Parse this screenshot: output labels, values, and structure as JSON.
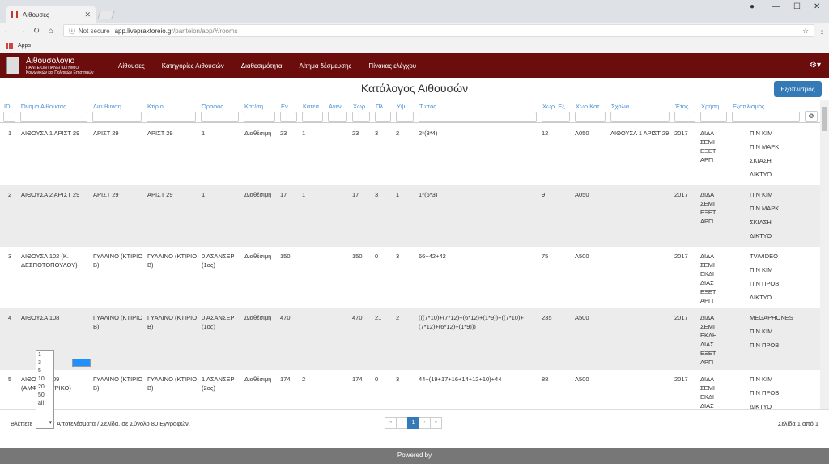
{
  "browser": {
    "tab_title": "Αίθουσες",
    "not_secure": "Not secure",
    "url_host": "app.livepraktoreio.gr",
    "url_path": "/panteion/app/#/rooms",
    "bookmark": "Apps"
  },
  "app": {
    "logo_title": "Αιθουσολόγιο",
    "logo_sub1": "ΠΑΝΤΕΙΟΝ ΠΑΝΕΠΙΣΤΗΜΙΟ",
    "logo_sub2": "Κοινωνικών και Πολιτικών Επιστημών",
    "nav": [
      "Αίθουσες",
      "Κατηγορίες Αιθουσών",
      "Διαθεσιμότητα",
      "Αίτημα δέσμευσης",
      "Πίνακας ελέγχου"
    ]
  },
  "page": {
    "title": "Κατάλογος Αιθουσών",
    "equip_button": "Εξοπλισμός"
  },
  "table": {
    "headers": [
      "ID",
      "Όνομα Αιθουσας",
      "Διευθυνση",
      "Κτίριο",
      "Όροφος",
      "Κατ/ση",
      "Εν.",
      "Κατεσ.",
      "Ανεν.",
      "Χωρ.",
      "Πλ.",
      "Υψ.",
      "Τυπος",
      "Χωρ. Εξ.",
      "Χωρ.Κατ.",
      "Σχόλια",
      "Έτος",
      "Χρήση",
      "Εξοπλισμός"
    ],
    "rows": [
      {
        "id": "1",
        "name": "ΑΙΘΟΥΣΑ 1 ΑΡΙΣΤ 29",
        "address": "ΑΡΙΣΤ 29",
        "building": "ΑΡΙΣΤ 29",
        "floor": "1",
        "status": "Διαθέσιμη",
        "en": "23",
        "kates": "1",
        "anen": "",
        "xor": "23",
        "pl": "3",
        "ips": "2",
        "type": "2*(3*4)",
        "xorex": "12",
        "xorkat": "A050",
        "comments": "ΑΙΘΟΥΣΑ 1 ΑΡΙΣΤ 29",
        "year": "2017",
        "use": [
          "ΔΙΔΑ",
          "ΣΕΜΙ",
          "ΕΞΕΤ",
          "ΑΡΓΙ"
        ],
        "equip": [
          "ΠΙΝ ΚΙΜ",
          "ΠΙΝ ΜΑΡΚ",
          "ΣΚΙΑΣΗ",
          "ΔΙΚΤΥΟ"
        ]
      },
      {
        "id": "2",
        "name": "ΑΙΘΟΥΣΑ 2 ΑΡΙΣΤ 29",
        "address": "ΑΡΙΣΤ 29",
        "building": "ΑΡΙΣΤ 29",
        "floor": "1",
        "status": "Διαθέσιμη",
        "en": "17",
        "kates": "1",
        "anen": "",
        "xor": "17",
        "pl": "3",
        "ips": "1",
        "type": "1*(6*3)",
        "xorex": "9",
        "xorkat": "A050",
        "comments": "",
        "year": "2017",
        "use": [
          "ΔΙΔΑ",
          "ΣΕΜΙ",
          "ΕΞΕΤ",
          "ΑΡΓΙ"
        ],
        "equip": [
          "ΠΙΝ ΚΙΜ",
          "ΠΙΝ ΜΑΡΚ",
          "ΣΚΙΑΣΗ",
          "ΔΙΚΤΥΟ"
        ]
      },
      {
        "id": "3",
        "name": "ΑΙΘΟΥΣΑ 102 (Κ. ΔΕΣΠΟΤΟΠΟΥΛΟΥ)",
        "address": "ΓΥΑΛΙΝΟ (ΚΤΙΡΙΟ Β)",
        "building": "ΓΥΑΛΙΝΟ (ΚΤΙΡΙΟ Β)",
        "floor": "0 ΑΣΑΝΣΕΡ (1ος)",
        "status": "Διαθέσιμη",
        "en": "150",
        "kates": "",
        "anen": "",
        "xor": "150",
        "pl": "0",
        "ips": "3",
        "type": "66+42+42",
        "xorex": "75",
        "xorkat": "A500",
        "comments": "",
        "year": "2017",
        "use": [
          "ΔΙΔΑ",
          "ΣΕΜΙ",
          "ΕΚΔΗ",
          "ΔΙΑΣ",
          "ΕΞΕΤ",
          "ΑΡΓΙ"
        ],
        "equip": [
          "TV/VIDEO",
          "ΠΙΝ ΚΙΜ",
          "ΠΙΝ ΠΡΟΒ",
          "ΔΙΚΤΥΟ"
        ]
      },
      {
        "id": "4",
        "name": "ΑΙΘΟΥΣΑ 108",
        "address": "ΓΥΑΛΙΝΟ (ΚΤΙΡΙΟ Β)",
        "building": "ΓΥΑΛΙΝΟ (ΚΤΙΡΙΟ Β)",
        "floor": "0 ΑΣΑΝΣΕΡ (1ος)",
        "status": "Διαθέσιμη",
        "en": "470",
        "kates": "",
        "anen": "",
        "xor": "470",
        "pl": "21",
        "ips": "2",
        "type": "(((7*10)+(7*12)+(6*12)+(1*9))+((7*10)+(7*12)+(6*12)+(1*9)))",
        "xorex": "235",
        "xorkat": "A500",
        "comments": "",
        "year": "2017",
        "use": [
          "ΔΙΔΑ",
          "ΣΕΜΙ",
          "ΕΚΔΗ",
          "ΔΙΑΣ",
          "ΕΞΕΤ",
          "ΑΡΓΙ"
        ],
        "equip": [
          "MEGAPHONES",
          "ΠΙΝ ΚΙΜ",
          "ΠΙΝ ΠΡΟΒ"
        ]
      },
      {
        "id": "5",
        "name": "ΑΙΘΟΥΣΑ 209 (ΑΜΦΙΘΕΑΤΡΙΚΟ)",
        "address": "ΓΥΑΛΙΝΟ (ΚΤΙΡΙΟ Β)",
        "building": "ΓΥΑΛΙΝΟ (ΚΤΙΡΙΟ Β)",
        "floor": "1 ΑΣΑΝΣΕΡ (2ος)",
        "status": "Διαθέσιμη",
        "en": "174",
        "kates": "2",
        "anen": "",
        "xor": "174",
        "pl": "0",
        "ips": "3",
        "type": "44+(19+17+16+14+12+10)+44",
        "xorex": "88",
        "xorkat": "A500",
        "comments": "",
        "year": "2017",
        "use": [
          "ΔΙΔΑ",
          "ΣΕΜΙ",
          "ΕΚΔΗ",
          "ΔΙΑΣ"
        ],
        "equip": [
          "ΠΙΝ ΚΙΜ",
          "ΠΙΝ ΠΡΟΒ",
          "ΔΙΚΤΥΟ"
        ]
      }
    ]
  },
  "pagesize": {
    "options": [
      "",
      "1",
      "3",
      "5",
      "10",
      "20",
      "50",
      "all"
    ],
    "selected": ""
  },
  "footer": {
    "show_prefix": "Βλέπετε",
    "show_suffix": "Αποτελέσματα / Σελίδα, σε Σύνολο 80 Εγγραφών.",
    "pager": [
      "«",
      "‹",
      "1",
      "›",
      "»"
    ],
    "current_page": "1",
    "page_info": "Σελίδα 1 από 1",
    "powered_prefix": "Powered by"
  }
}
